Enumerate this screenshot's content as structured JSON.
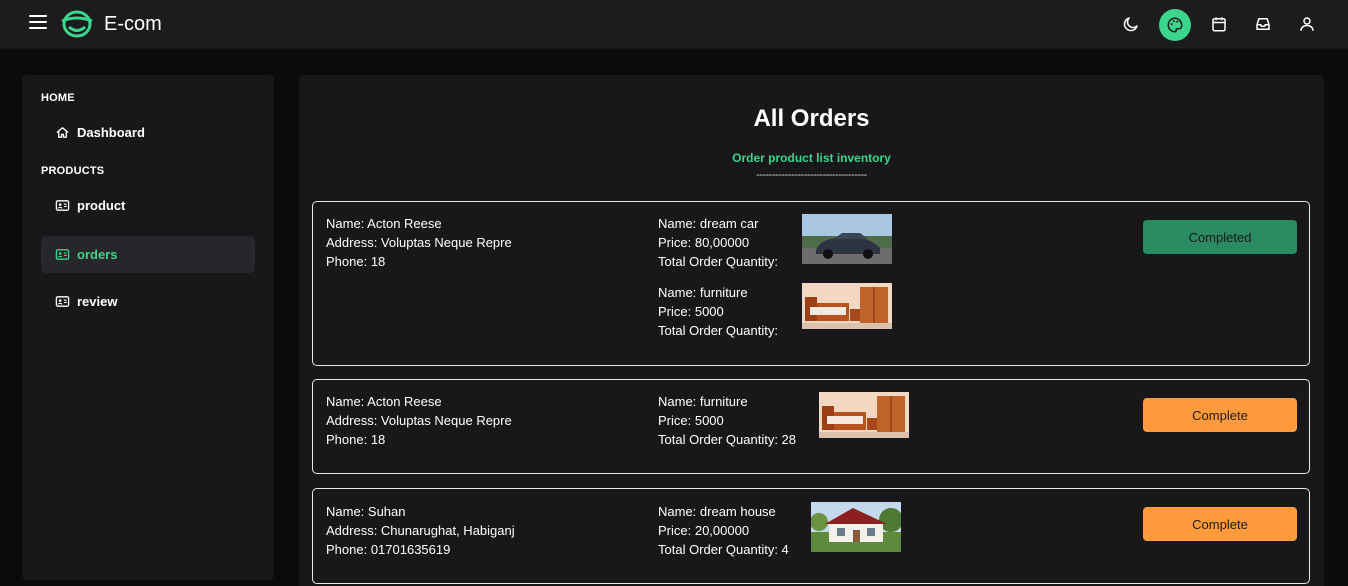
{
  "app": {
    "brand": "E-com"
  },
  "colors": {
    "accent": "#3bd58b",
    "completed": "#2a8a62",
    "pending": "#ff9a3d",
    "panel": "#18181b",
    "topbar": "#1c1c1f"
  },
  "topbar_icons": [
    "moon-icon",
    "palette-icon",
    "calendar-icon",
    "inbox-icon",
    "user-icon"
  ],
  "sidebar": {
    "sections": [
      {
        "label": "HOME",
        "items": [
          {
            "label": "Dashboard",
            "icon": "home-icon"
          }
        ]
      },
      {
        "label": "PRODUCTS",
        "items": [
          {
            "label": "product",
            "icon": "id-card-icon"
          },
          {
            "label": "orders",
            "icon": "id-card-icon",
            "active": true
          },
          {
            "label": "review",
            "icon": "id-card-icon"
          }
        ]
      }
    ]
  },
  "main": {
    "title": "All Orders",
    "subtitle": "Order product list inventory",
    "divider": "-----------------------------------"
  },
  "orders": [
    {
      "name": "Name: Acton Reese",
      "address": "Address: Voluptas Neque Repre",
      "phone": "Phone: 18",
      "items": [
        {
          "name": "Name: dream car",
          "price": "Price: 80,00000",
          "qty": "Total Order Quantity:",
          "image": "car-photo"
        },
        {
          "name": "Name: furniture",
          "price": "Price: 5000",
          "qty": "Total Order Quantity:",
          "image": "furniture-photo"
        }
      ],
      "status": "Completed"
    },
    {
      "name": "Name: Acton Reese",
      "address": "Address: Voluptas Neque Repre",
      "phone": "Phone: 18",
      "items": [
        {
          "name": "Name: furniture",
          "price": "Price: 5000",
          "qty": "Total Order Quantity: 28",
          "image": "furniture-photo"
        }
      ],
      "status": "Complete"
    },
    {
      "name": "Name: Suhan",
      "address": "Address: Chunarughat, Habiganj",
      "phone": "Phone: 01701635619",
      "items": [
        {
          "name": "Name: dream house",
          "price": "Price: 20,00000",
          "qty": "Total Order Quantity: 4",
          "image": "house-photo"
        }
      ],
      "status": "Complete"
    }
  ]
}
